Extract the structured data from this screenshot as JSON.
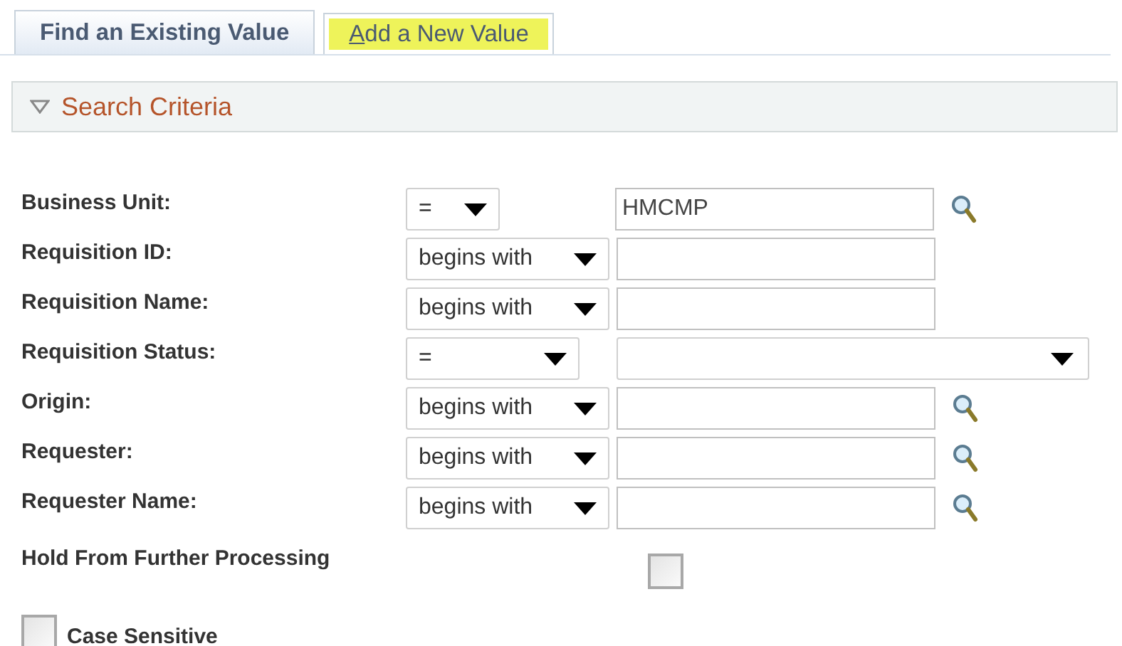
{
  "tabs": [
    {
      "label": "Find an Existing Value",
      "selected": true
    },
    {
      "label": "Add a New Value",
      "selected": false
    }
  ],
  "section": {
    "title": "Search Criteria",
    "expanded": true
  },
  "fields": [
    {
      "label": "Business Unit:",
      "operator": "=",
      "value": "HMCMP",
      "kind": "lookup"
    },
    {
      "label": "Requisition ID:",
      "operator": "begins with",
      "kind": "text"
    },
    {
      "label": "Requisition Name:",
      "operator": "begins with",
      "kind": "text"
    },
    {
      "label": "Requisition Status:",
      "operator": "=",
      "kind": "dropdown"
    },
    {
      "label": "Origin:",
      "operator": "begins with",
      "kind": "lookup"
    },
    {
      "label": "Requester:",
      "operator": "begins with",
      "kind": "lookup"
    },
    {
      "label": "Requester Name:",
      "operator": "begins with",
      "kind": "lookup"
    }
  ],
  "hold": {
    "label": "Hold From Further Processing",
    "checked": false
  },
  "case_sensitive": {
    "label": "Case Sensitive",
    "checked": false
  }
}
